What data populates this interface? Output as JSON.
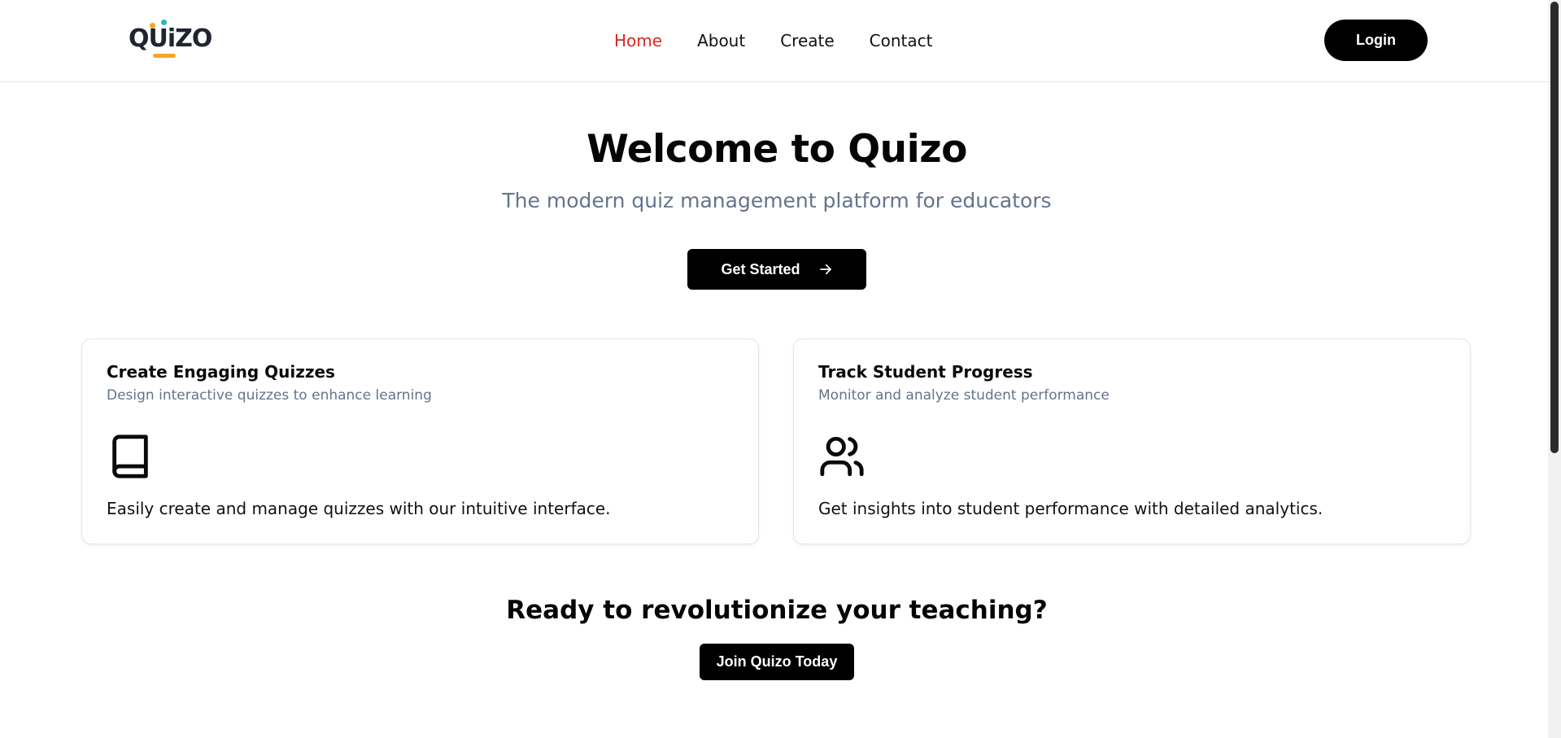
{
  "header": {
    "logo_text": "QUiZO",
    "nav": [
      {
        "label": "Home",
        "active": true
      },
      {
        "label": "About",
        "active": false
      },
      {
        "label": "Create",
        "active": false
      },
      {
        "label": "Contact",
        "active": false
      }
    ],
    "login_label": "Login"
  },
  "hero": {
    "title": "Welcome to Quizo",
    "subtitle": "The modern quiz management platform for educators",
    "cta_label": "Get Started",
    "cta_icon": "arrow-right-icon"
  },
  "features": [
    {
      "title": "Create Engaging Quizzes",
      "description": "Design interactive quizzes to enhance learning",
      "icon": "book-icon",
      "body": "Easily create and manage quizzes with our intuitive interface."
    },
    {
      "title": "Track Student Progress",
      "description": "Monitor and analyze student performance",
      "icon": "users-icon",
      "body": "Get insights into student performance with detailed analytics."
    }
  ],
  "cta": {
    "title": "Ready to revolutionize your teaching?",
    "button_label": "Join Quizo Today"
  },
  "colors": {
    "accent_active_nav": "#dc2626",
    "muted_text": "#64748b",
    "button_bg": "#000000",
    "logo_orange": "#f5a623",
    "logo_teal": "#2bb3c0"
  }
}
